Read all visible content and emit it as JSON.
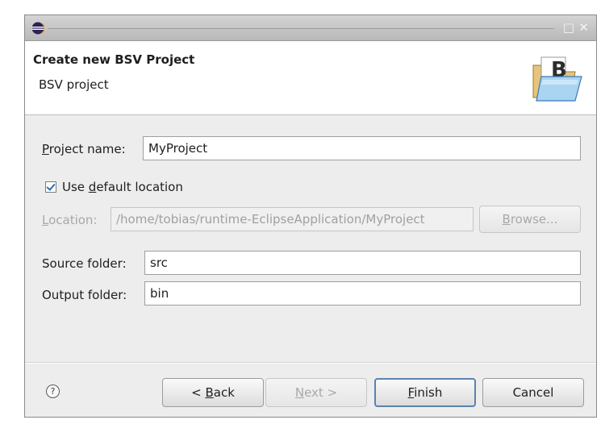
{
  "window": {
    "title": "",
    "maximize_glyph": "□",
    "close_glyph": "✕"
  },
  "header": {
    "title": "Create new BSV Project",
    "subtitle": "BSV project",
    "icon": "bsv-folder-icon"
  },
  "form": {
    "project_name": {
      "label": "Project name:",
      "value": "MyProject"
    },
    "use_default_location": {
      "label": "Use default location",
      "checked": true
    },
    "location": {
      "label": "Location:",
      "value": "/home/tobias/runtime-EclipseApplication/MyProject",
      "enabled": false
    },
    "browse_label": "Browse...",
    "source_folder": {
      "label": "Source folder:",
      "value": "src"
    },
    "output_folder": {
      "label": "Output folder:",
      "value": "bin"
    }
  },
  "buttons": {
    "back": "< Back",
    "next": "Next >",
    "finish": "Finish",
    "cancel": "Cancel",
    "help": "?"
  },
  "colors": {
    "accent": "#5b83ad",
    "check": "#2a6bb8",
    "disabled_text": "#a8a8a8"
  }
}
